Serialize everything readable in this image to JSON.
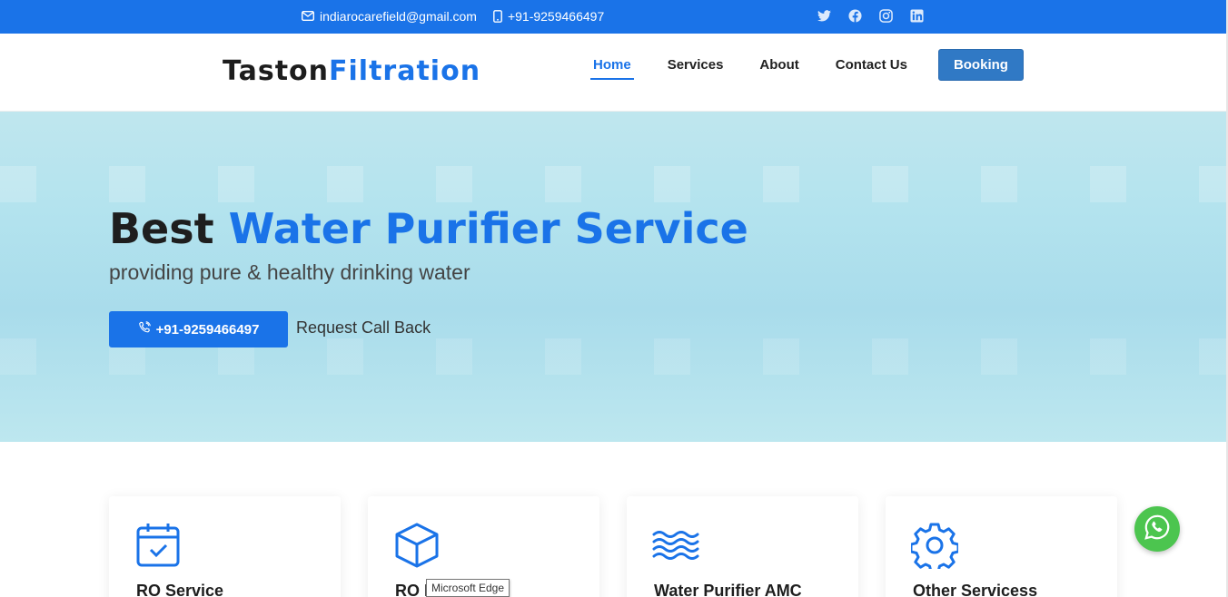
{
  "topbar": {
    "email": "indiarocarefield@gmail.com",
    "phone": "+91-9259466497",
    "social": [
      "twitter-icon",
      "facebook-icon",
      "instagram-icon",
      "linkedin-icon"
    ]
  },
  "header": {
    "logo_part1": "Taston",
    "logo_part2": "Filtration",
    "nav": [
      "Home",
      "Services",
      "About",
      "Contact Us"
    ],
    "active": "Home",
    "booking_label": "Booking"
  },
  "hero": {
    "title_part1": "Best",
    "title_part2": "Water Purifier Service",
    "subtitle": "providing pure & healthy drinking water",
    "call_button": "+91-9259466497",
    "callback_label": "Request Call Back"
  },
  "cards": [
    {
      "title": "RO Service",
      "icon": "calendar-check-icon"
    },
    {
      "title": "RO I",
      "icon": "box-icon"
    },
    {
      "title": "Water Purifier AMC",
      "icon": "water-waves-icon"
    },
    {
      "title": "Other Servicess",
      "icon": "gear-icon"
    }
  ],
  "tooltip": "Microsoft Edge",
  "colors": {
    "brand": "#1a73e8",
    "booking": "#3079c5",
    "whatsapp": "#4cc54f"
  }
}
